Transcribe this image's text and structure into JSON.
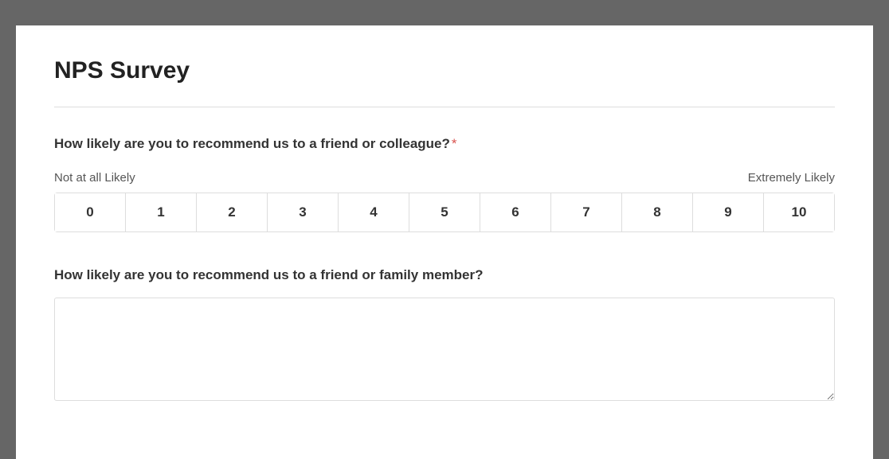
{
  "survey": {
    "title": "NPS Survey",
    "question1": {
      "label": "How likely are you to recommend us to a friend or colleague?",
      "required_marker": "*",
      "left_label": "Not at all Likely",
      "right_label": "Extremely Likely",
      "options": [
        "0",
        "1",
        "2",
        "3",
        "4",
        "5",
        "6",
        "7",
        "8",
        "9",
        "10"
      ]
    },
    "question2": {
      "label": "How likely are you to recommend us to a friend or family member?",
      "value": ""
    }
  }
}
